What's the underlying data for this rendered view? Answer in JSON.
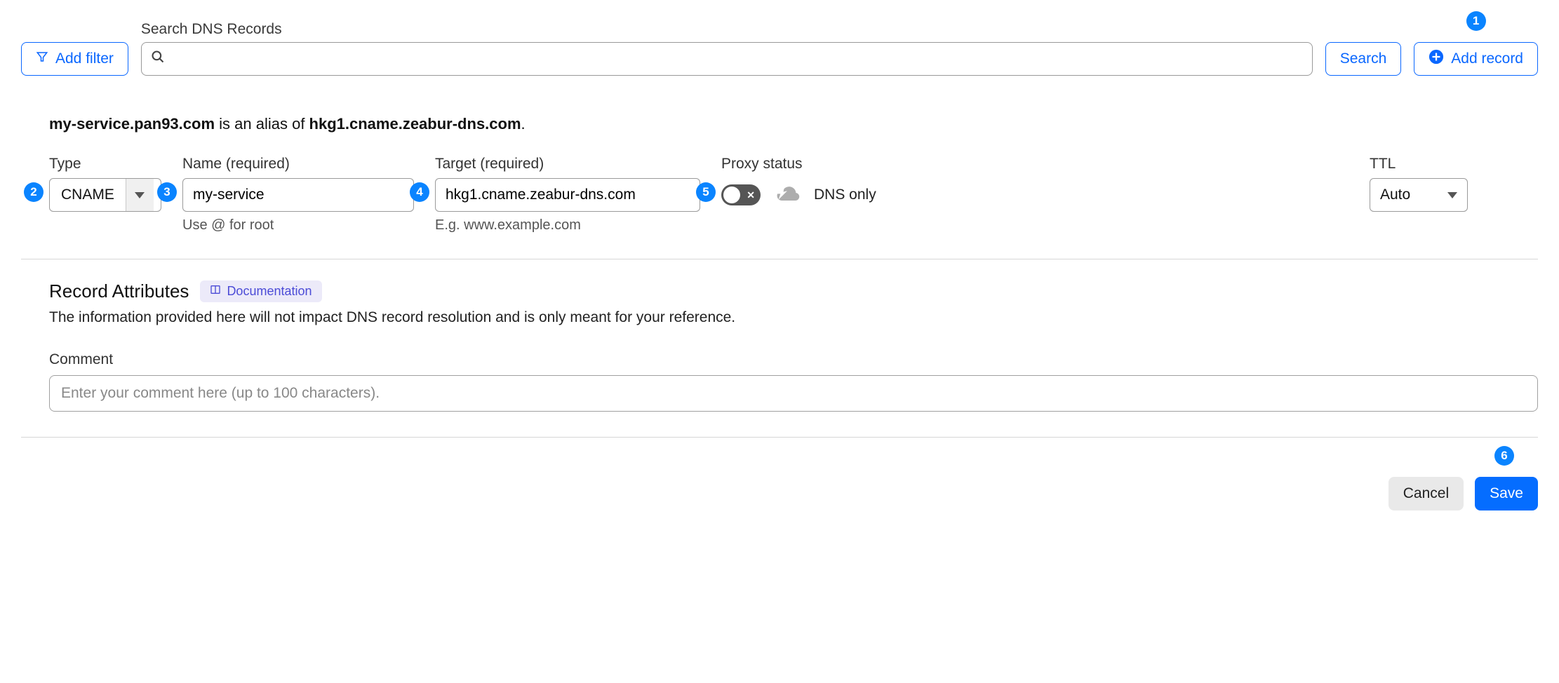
{
  "top": {
    "add_filter": "Add filter",
    "search_label": "Search DNS Records",
    "search_placeholder": "",
    "search_button": "Search",
    "add_record": "Add record"
  },
  "heading": {
    "alias_host": "my-service.pan93.com",
    "alias_mid": " is an alias of ",
    "alias_target": "hkg1.cname.zeabur-dns.com",
    "period": "."
  },
  "fields": {
    "type": {
      "label": "Type",
      "value": "CNAME"
    },
    "name": {
      "label": "Name (required)",
      "value": "my-service",
      "help": "Use @ for root"
    },
    "target": {
      "label": "Target (required)",
      "value": "hkg1.cname.zeabur-dns.com",
      "help": "E.g. www.example.com"
    },
    "proxy": {
      "label": "Proxy status",
      "value": "DNS only"
    },
    "ttl": {
      "label": "TTL",
      "value": "Auto"
    }
  },
  "attrs": {
    "title": "Record Attributes",
    "doc_link": "Documentation",
    "description": "The information provided here will not impact DNS record resolution and is only meant for your reference.",
    "comment_label": "Comment",
    "comment_placeholder": "Enter your comment here (up to 100 characters)."
  },
  "footer": {
    "cancel": "Cancel",
    "save": "Save"
  },
  "badges": [
    "1",
    "2",
    "3",
    "4",
    "5",
    "6"
  ]
}
